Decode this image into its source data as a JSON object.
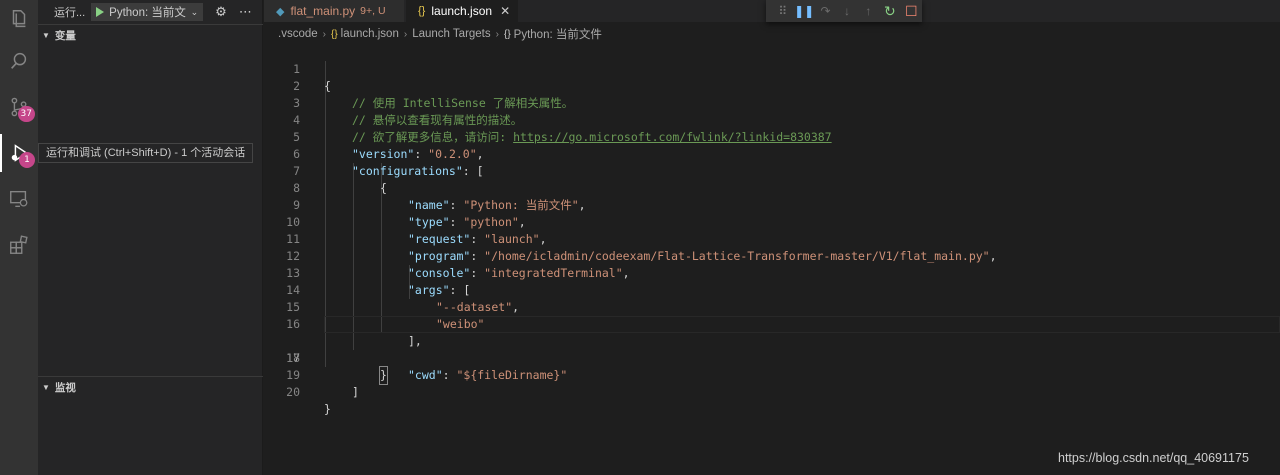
{
  "activity_bar": {
    "scm_badge": "37",
    "debug_badge": "1"
  },
  "sidebar": {
    "title": "运行...",
    "launch_config": "Python: 当前文",
    "variables_label": "变量",
    "watch_label": "监视"
  },
  "tooltip": "运行和调试 (Ctrl+Shift+D) - 1 个活动会话",
  "tabs": [
    {
      "name": "flat_main.py",
      "status": "9+, U"
    },
    {
      "name": "launch.json",
      "close": "✕"
    }
  ],
  "breadcrumb": [
    ".vscode",
    "launch.json",
    "Launch Targets",
    "Python: 当前文件"
  ],
  "editor": {
    "current_line": "17",
    "line_numbers": [
      "1",
      "2",
      "3",
      "4",
      "5",
      "6",
      "7",
      "8",
      "9",
      "10",
      "11",
      "12",
      "13",
      "14",
      "15",
      "16",
      "17",
      "18",
      "19",
      "20"
    ],
    "comment_1": "// 使用 IntelliSense 了解相关属性。",
    "comment_2": "// 悬停以查看现有属性的描述。",
    "comment_3": "// 欲了解更多信息，请访问: ",
    "comment_3_link": "https://go.microsoft.com/fwlink/?linkid=830387",
    "version_key": "\"version\"",
    "version_value": "\"0.2.0\"",
    "configurations_key": "\"configurations\"",
    "name_key": "\"name\"",
    "name_value": "\"Python: 当前文件\"",
    "type_key": "\"type\"",
    "type_value": "\"python\"",
    "request_key": "\"request\"",
    "request_value": "\"launch\"",
    "program_key": "\"program\"",
    "program_value": "\"/home/icladmin/codeexam/Flat-Lattice-Transformer-master/V1/flat_main.py\"",
    "console_key": "\"console\"",
    "console_value": "\"integratedTerminal\"",
    "args_key": "\"args\"",
    "arg_1": "\"--dataset\"",
    "arg_2": "\"weibo\"",
    "cwd_key": "\"cwd\"",
    "cwd_value": "\"${fileDirname}\""
  },
  "watermark": "https://blog.csdn.net/qq_40691175",
  "colors": {
    "accent_debug_play": "#89d185",
    "badge": "#c5468a",
    "json_key": "#9cdcfe",
    "json_string": "#ce9178",
    "comment": "#6a9955"
  }
}
